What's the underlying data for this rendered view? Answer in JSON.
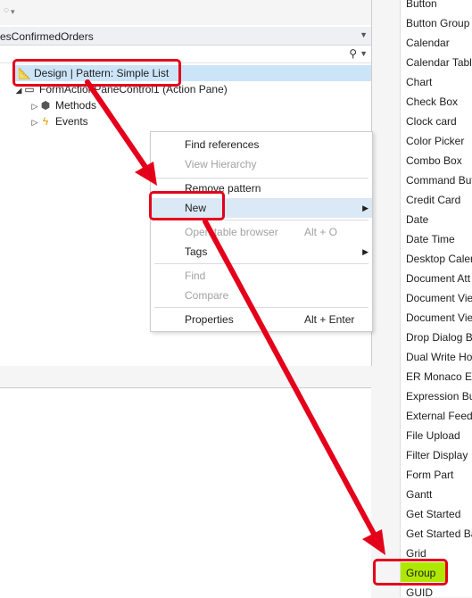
{
  "header": {
    "file_tab": "esConfirmedOrders"
  },
  "tree": {
    "selected_node": "Design | Pattern: Simple List",
    "action_pane": "FormActionPaneControl1 (Action Pane)",
    "methods": "Methods",
    "events": "Events"
  },
  "context_menu": {
    "items": [
      {
        "label": "Find references",
        "shortcut": "",
        "disabled": false
      },
      {
        "label": "View Hierarchy",
        "shortcut": "",
        "disabled": true
      },
      {
        "label": "Remove pattern",
        "shortcut": "",
        "disabled": false
      },
      {
        "label": "New",
        "shortcut": "",
        "disabled": false
      },
      {
        "label": "Open table browser",
        "shortcut": "Alt + O",
        "disabled": true
      },
      {
        "label": "Tags",
        "shortcut": "",
        "disabled": false
      },
      {
        "label": "Find",
        "shortcut": "",
        "disabled": true
      },
      {
        "label": "Compare",
        "shortcut": "",
        "disabled": true
      },
      {
        "label": "Properties",
        "shortcut": "Alt + Enter",
        "disabled": false
      }
    ]
  },
  "toolbox": {
    "items": [
      "Button",
      "Button Group",
      "Calendar",
      "Calendar Table",
      "Chart",
      "Check Box",
      "Clock card",
      "Color Picker",
      "Combo Box",
      "Command Butt",
      "Credit Card",
      "Date",
      "Date Time",
      "Desktop Calen",
      "Document Att",
      "Document Vie",
      "Document Vie",
      "Drop Dialog B",
      "Dual Write Ho",
      "ER Monaco Ed",
      "Expression Bui",
      "External Feed",
      "File Upload",
      "Filter Display",
      "Form Part",
      "Gantt",
      "Get Started",
      "Get Started Ba",
      "Grid",
      "Group",
      "GUID"
    ],
    "highlighted": "Group"
  },
  "colors": {
    "annotation": "#e4001b",
    "group_highlight": "#aee800",
    "selection": "#cce4f7"
  }
}
